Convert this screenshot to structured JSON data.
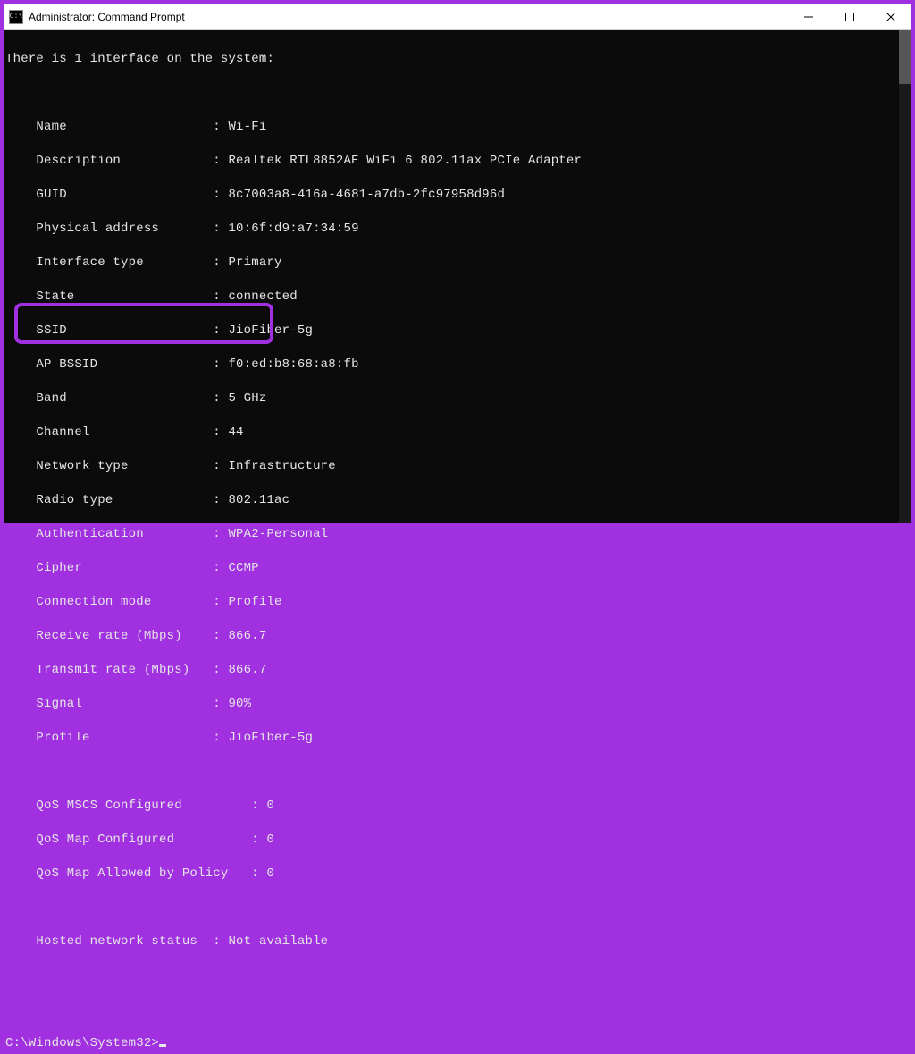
{
  "window": {
    "title": "Administrator: Command Prompt"
  },
  "header_line": "There is 1 interface on the system:",
  "fields": {
    "name": {
      "label": "Name",
      "value": "Wi-Fi"
    },
    "description": {
      "label": "Description",
      "value": "Realtek RTL8852AE WiFi 6 802.11ax PCIe Adapter"
    },
    "guid": {
      "label": "GUID",
      "value": "8c7003a8-416a-4681-a7db-2fc97958d96d"
    },
    "phys": {
      "label": "Physical address",
      "value": "10:6f:d9:a7:34:59"
    },
    "iftype": {
      "label": "Interface type",
      "value": "Primary"
    },
    "state": {
      "label": "State",
      "value": "connected"
    },
    "ssid": {
      "label": "SSID",
      "value": "JioFiber-5g"
    },
    "bssid": {
      "label": "AP BSSID",
      "value": "f0:ed:b8:68:a8:fb"
    },
    "band": {
      "label": "Band",
      "value": "5 GHz"
    },
    "channel": {
      "label": "Channel",
      "value": "44"
    },
    "nettype": {
      "label": "Network type",
      "value": "Infrastructure"
    },
    "radiotype": {
      "label": "Radio type",
      "value": "802.11ac"
    },
    "auth": {
      "label": "Authentication",
      "value": "WPA2-Personal"
    },
    "cipher": {
      "label": "Cipher",
      "value": "CCMP"
    },
    "connmode": {
      "label": "Connection mode",
      "value": "Profile"
    },
    "rx": {
      "label": "Receive rate (Mbps)",
      "value": "866.7"
    },
    "tx": {
      "label": "Transmit rate (Mbps)",
      "value": "866.7"
    },
    "signal": {
      "label": "Signal",
      "value": "90%"
    },
    "profile": {
      "label": "Profile",
      "value": "JioFiber-5g"
    }
  },
  "qos": {
    "mscs": {
      "label": "QoS MSCS Configured",
      "value": "0"
    },
    "map": {
      "label": "QoS Map Configured",
      "value": "0"
    },
    "policy": {
      "label": "QoS Map Allowed by Policy",
      "value": "0"
    }
  },
  "hosted": {
    "label": "Hosted network status",
    "value": "Not available"
  },
  "prompt": "C:\\Windows\\System32>"
}
